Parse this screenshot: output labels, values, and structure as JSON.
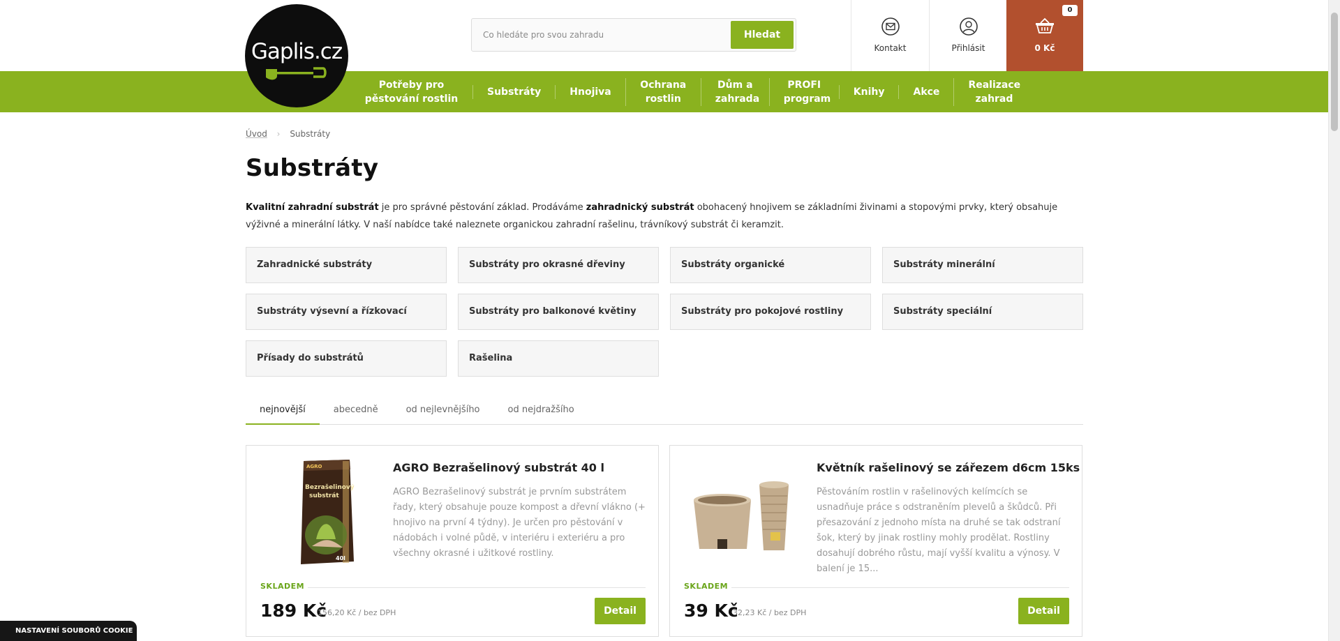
{
  "logo": {
    "text": "Gaplis.cz"
  },
  "search": {
    "placeholder": "Co hledáte pro svou zahradu",
    "button": "Hledat"
  },
  "header": {
    "contact": "Kontakt",
    "login": "Přihlásit",
    "cart_total": "0 Kč",
    "cart_count": "0"
  },
  "nav": [
    "Potřeby pro pěstování rostlin",
    "Substráty",
    "Hnojiva",
    "Ochrana rostlin",
    "Dům a zahrada",
    "PROFI program",
    "Knihy",
    "Akce",
    "Realizace zahrad"
  ],
  "breadcrumb": {
    "home": "Úvod",
    "current": "Substráty"
  },
  "page_title": "Substráty",
  "intro": {
    "b1": "Kvalitní zahradní substrát",
    "t1": " je pro správné pěstování základ. Prodáváme ",
    "b2": "zahradnický substrát",
    "t2": " obohacený hnojivem se základními živinami a stopovými prvky, který obsahuje výživné a minerální látky. V naší nabídce také naleznete organickou zahradní rašelinu, trávníkový substrát či keramzit."
  },
  "categories": [
    "Zahradnické substráty",
    "Substráty pro okrasné dřeviny",
    "Substráty organické",
    "Substráty minerální",
    "Substráty výsevní a řízkovací",
    "Substráty pro balkonové květiny",
    "Substráty pro pokojové rostliny",
    "Substráty speciální",
    "Přísady do substrátů",
    "Rašelina"
  ],
  "sort_tabs": [
    "nejnovější",
    "abecedně",
    "od nejlevnějšího",
    "od nejdražšího"
  ],
  "products": [
    {
      "title": "AGRO Bezrašelinový substrát 40 l",
      "description": "AGRO Bezrašelinový substrát je prvním substrátem řady, který obsahuje pouze kompost a dřevní vlákno (+ hnojivo na první 4 týdny). Je určen pro pěstování v nádobách i volné půdě, v interiéru i exteriéru a pro všechny okrasné i užitkové rostliny.",
      "stock": "SKLADEM",
      "price": "189 Kč",
      "price_vat": "156,20 Kč / bez DPH",
      "button": "Detail",
      "bag_brand": "AGRO",
      "bag_line1": "Bezrašelinový",
      "bag_line2": "substrát",
      "bag_volume": "40l"
    },
    {
      "title": "Květník rašelinový se zářezem d6cm 15ks",
      "description": "Pěstováním rostlin v rašelinových kelímcích se usnadňuje práce s odstraněním plevelů a škůdců. Při přesazování z jednoho místa na druhé se tak odstraní šok, který by jinak rostliny mohly prodělat. Rostliny dosahují dobrého růstu, mají vyšší kvalitu a výnosy. V balení je 15...",
      "stock": "SKLADEM",
      "price": "39 Kč",
      "price_vat": "32,23 Kč / bez DPH",
      "button": "Detail"
    }
  ],
  "cookie": "NASTAVENÍ SOUBORŮ COOKIE",
  "colors": {
    "brand_green": "#8ab21f",
    "cart_red": "#b2502e",
    "stock_green": "#6aa51a"
  }
}
